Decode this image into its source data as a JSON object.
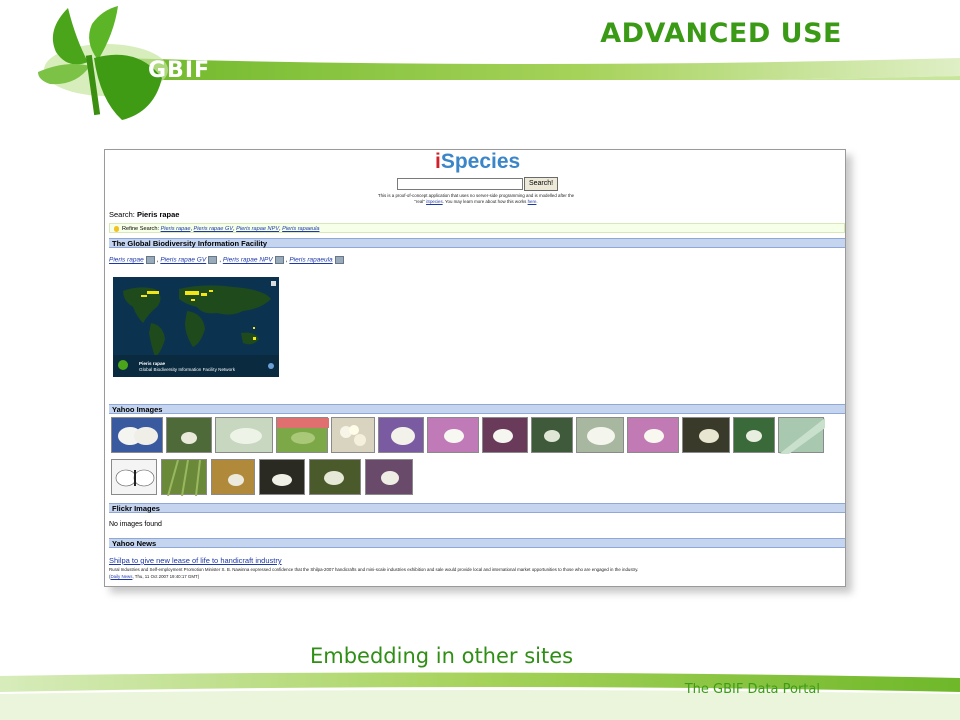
{
  "slide": {
    "logo_text": "GBIF",
    "title": "ADVANCED USE",
    "caption": "Embedding in other sites",
    "footer": "The GBIF Data Portal",
    "colors": {
      "accent_green": "#3a9a16",
      "band_green": "#8cc63f",
      "band_light": "#d7ecbb"
    }
  },
  "ispecies": {
    "logo_i": "i",
    "logo_rest": "Species",
    "search_button": "Search!",
    "intro_1": "This is a proof-of-concept application that uses no server-side programming and is modelled after the",
    "intro_2a": "\"real\"",
    "intro_link": "iSpecies",
    "intro_2b": ". You may learn more about how this works",
    "intro_link2": "here",
    "search_label": "Search:",
    "search_term": "Pieris rapae",
    "refine_label": "Refine Search:",
    "refine_links": [
      "Pieris rapae",
      "Pieris rapae GV",
      "Pieris rapae NPV",
      "Pieris rapaeula"
    ],
    "sections": {
      "gbif": "The Global Biodiversity Information Facility",
      "yahoo_images": "Yahoo Images",
      "flickr": "Flickr Images",
      "yahoo_news": "Yahoo News"
    },
    "gbif_links": [
      "Pieris rapae",
      "Pieris rapae GV",
      "Pieris rapae NPV",
      "Pieris rapaeula"
    ],
    "map_caption_1": "Pieris rapae",
    "map_caption_2": "Global Biodiversity Information Facility Network",
    "flickr_empty": "No images found",
    "news": {
      "headline": "Shilpa to give new lease of life to handicraft industry",
      "summary": "Rural Industries and Self-employment Promotion Minister S. B. Nawinna expressed confidence that the Shilpa-2007 handicrafts and mini-scale industries exhibition and sale would provide local and international market opportunities to those who are engaged in the industry.",
      "source": "Daily News",
      "date": ", Thu, 11 Oct 2007 19:40:17 GMT"
    }
  }
}
